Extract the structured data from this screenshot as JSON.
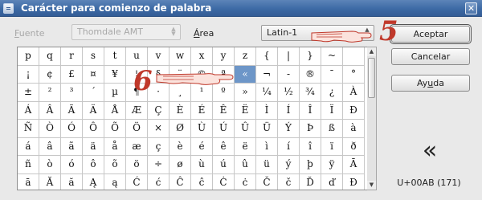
{
  "window": {
    "title": "Carácter para comienzo de palabra",
    "close_glyph": "✕"
  },
  "fuente": {
    "label_mnemonic": "F",
    "label_rest": "uente",
    "value": "Thomdale AMT"
  },
  "area": {
    "label_mnemonic": "Á",
    "label_rest": "rea",
    "value": "Latin-1"
  },
  "buttons": {
    "accept": "Aceptar",
    "cancel": "Cancelar",
    "help_pre": "Ay",
    "help_mnemonic": "u",
    "help_post": "da"
  },
  "grid": {
    "rows": [
      [
        "p",
        "q",
        "r",
        "s",
        "t",
        "u",
        "v",
        "w",
        "x",
        "y",
        "z",
        "{",
        "|",
        "}",
        "~",
        ""
      ],
      [
        "¡",
        "¢",
        "£",
        "¤",
        "¥",
        "¦",
        "§",
        "¨",
        "©",
        "ª",
        "«",
        "¬",
        "-",
        "®",
        "¯",
        "°"
      ],
      [
        "±",
        "²",
        "³",
        "´",
        "µ",
        "¶",
        "·",
        "¸",
        "¹",
        "º",
        "»",
        "¼",
        "½",
        "¾",
        "¿",
        "À"
      ],
      [
        "Á",
        "Â",
        "Ã",
        "Ä",
        "Å",
        "Æ",
        "Ç",
        "È",
        "É",
        "Ê",
        "Ë",
        "Ì",
        "Í",
        "Î",
        "Ï",
        "Ð"
      ],
      [
        "Ñ",
        "Ò",
        "Ó",
        "Ô",
        "Õ",
        "Ö",
        "×",
        "Ø",
        "Ù",
        "Ú",
        "Û",
        "Ü",
        "Ý",
        "Þ",
        "ß",
        "à"
      ],
      [
        "á",
        "â",
        "ã",
        "ä",
        "å",
        "æ",
        "ç",
        "è",
        "é",
        "ê",
        "ë",
        "ì",
        "í",
        "î",
        "ï",
        "ð"
      ],
      [
        "ñ",
        "ò",
        "ó",
        "ô",
        "õ",
        "ö",
        "÷",
        "ø",
        "ù",
        "ú",
        "û",
        "ü",
        "ý",
        "þ",
        "ÿ",
        "Ā"
      ],
      [
        "ā",
        "Ă",
        "ă",
        "Ą",
        "ą",
        "Ć",
        "ć",
        "Ĉ",
        "ĉ",
        "Ċ",
        "ċ",
        "Č",
        "č",
        "Ď",
        "ď",
        "Đ"
      ]
    ],
    "selected": "«"
  },
  "preview": {
    "char": "«",
    "code": "U+00AB (171)"
  },
  "annotations": {
    "five": "5",
    "six": "6",
    "color": "#c0392b"
  }
}
